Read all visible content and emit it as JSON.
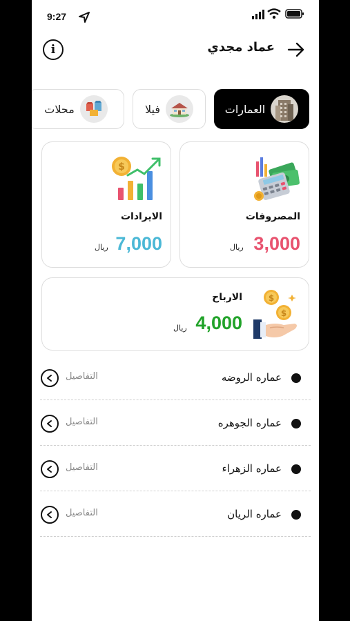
{
  "status": {
    "time": "9:27"
  },
  "header": {
    "title": "عماد مجدي"
  },
  "tabs": [
    {
      "label": "العمارات",
      "active": true
    },
    {
      "label": "فيلا",
      "active": false
    },
    {
      "label": "محلات",
      "active": false
    }
  ],
  "cards": {
    "expenses": {
      "title": "المصروفات",
      "value": "3,000",
      "currency": "ريال",
      "color": "#e8536f"
    },
    "revenues": {
      "title": "الايرادات",
      "value": "7,000",
      "currency": "ريال",
      "color": "#4bb8d6"
    },
    "profits": {
      "title": "الارباح",
      "value": "4,000",
      "currency": "ريال",
      "color": "#22a32a"
    }
  },
  "buildings": [
    {
      "name": "عماره الروضه",
      "action": "التفاصيل"
    },
    {
      "name": "عماره الجوهره",
      "action": "التفاصيل"
    },
    {
      "name": "عماره الزهراء",
      "action": "التفاصيل"
    },
    {
      "name": "عماره الريان",
      "action": "التفاصيل"
    }
  ]
}
